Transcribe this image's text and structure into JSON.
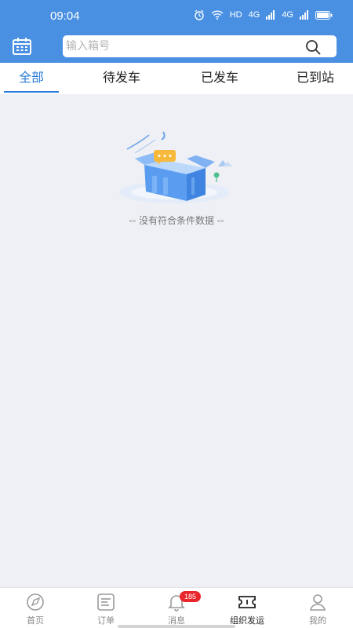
{
  "status_bar": {
    "time": "09:04",
    "network": "HD",
    "signal1": "4G",
    "signal2": "4G"
  },
  "header": {
    "search_placeholder": "输入箱号",
    "calendar_icon": "calendar-icon",
    "search_icon": "search-icon"
  },
  "tabs": [
    {
      "label": "全部",
      "active": true
    },
    {
      "label": "待发车",
      "active": false
    },
    {
      "label": "已发车",
      "active": false
    },
    {
      "label": "已到站",
      "active": false
    }
  ],
  "empty_state": {
    "text": "-- 没有符合条件数据 --",
    "icon": "empty-box-illustration"
  },
  "bottom_nav": [
    {
      "label": "首页",
      "icon": "compass-icon"
    },
    {
      "label": "订单",
      "icon": "order-list-icon"
    },
    {
      "label": "消息",
      "icon": "bell-icon",
      "badge": "185"
    },
    {
      "label": "组织发运",
      "icon": "ticket-icon",
      "active": true
    },
    {
      "label": "我的",
      "icon": "user-icon"
    }
  ],
  "colors": {
    "primary": "#4a90e2",
    "tab_active": "#2b7bd8",
    "badge": "#e8262b",
    "background": "#eef0f5"
  }
}
